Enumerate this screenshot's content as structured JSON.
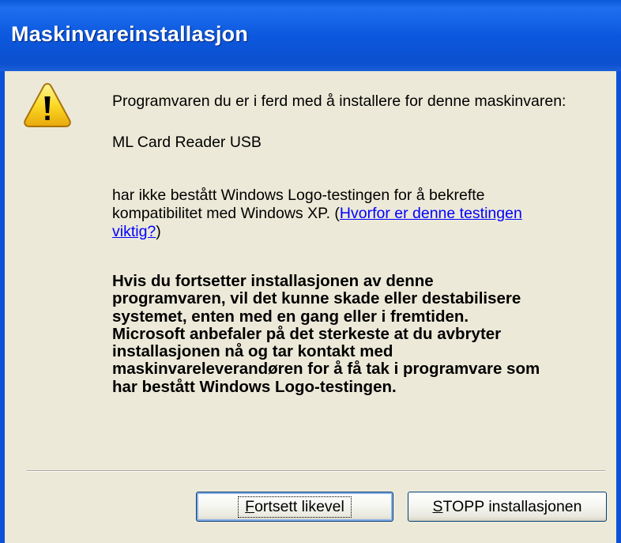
{
  "window": {
    "title": "Maskinvareinstallasjon"
  },
  "message": {
    "intro": "Programvaren du er i ferd med å installere for denne maskinvaren:",
    "device_name": "ML Card Reader USB",
    "not_passed": "har ikke bestått Windows Logo-testingen for å bekrefte",
    "compat_prefix": "kompatibilitet med Windows XP. (",
    "link_part1": "Hvorfor er denne testingen",
    "link_part2": "viktig?",
    "link_suffix": ")",
    "warning_lines": [
      "Hvis du fortsetter installasjonen av denne",
      "programvaren, vil det kunne skade eller  destabilisere",
      "systemet, enten med en gang eller i fremtiden.",
      "Microsoft anbefaler på det sterkeste at du avbryter",
      "installasjonen nå og tar kontakt med",
      "maskinvareleverandøren for å få tak i programvare som",
      "har bestått Windows Logo-testingen."
    ]
  },
  "buttons": {
    "continue": {
      "accel": "F",
      "rest": "ortsett likevel"
    },
    "stop": {
      "accel": "S",
      "rest": "TOPP installasjonen"
    }
  },
  "icons": {
    "warning": "warning-triangle-icon"
  },
  "colors": {
    "titlebar": "#0b50cf",
    "client_bg": "#ece9d8",
    "link": "#0000ff",
    "icon_yellow": "#f7d21c"
  }
}
